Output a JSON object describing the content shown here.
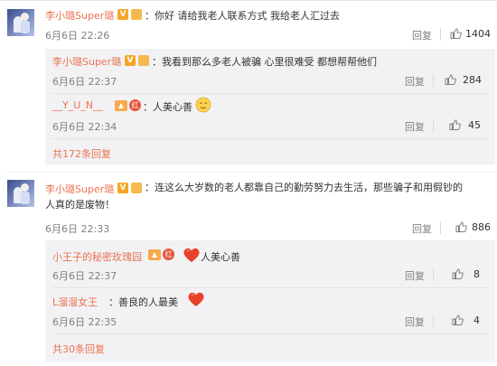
{
  "comments": [
    {
      "username": "李小璐Super璐",
      "text": "：你好 请给我老人联系方式 我给老人汇过去",
      "date": "6月6日 22:26",
      "reply_label": "回复",
      "likes": "1404",
      "replies": [
        {
          "username": "李小璐Super璐",
          "text": "：我看到那么多老人被骗 心里很难受 都想帮帮他们",
          "date": "6月6日 22:37",
          "reply_label": "回复",
          "likes": "284"
        },
        {
          "username": "__Y_U_N__",
          "text": "：人美心善",
          "date": "6月6日 22:34",
          "reply_label": "回复",
          "likes": "45"
        }
      ],
      "more_replies": "共172条回复"
    },
    {
      "username": "李小璐Super璐",
      "text": "：连这么大岁数的老人都靠自己的勤劳努力去生活，那些骗子和用假钞的人真的是废物！",
      "date": "6月6日 22:33",
      "reply_label": "回复",
      "likes": "886",
      "replies": [
        {
          "username": "小王子的秘密玫瑰园",
          "text": "人美心善",
          "date": "6月6日 22:37",
          "reply_label": "回复",
          "likes": "8"
        },
        {
          "username": "L溜溜女王",
          "text": "：善良的人最美",
          "date": "6月6日 22:35",
          "reply_label": "回复",
          "likes": "4"
        }
      ],
      "more_replies": "共30条回复"
    }
  ],
  "badges": {
    "verified": "V",
    "red": "红"
  },
  "colors": {
    "username": "#eb7350",
    "meta": "#808080",
    "sub_bg": "#f2f2f5",
    "heart": "#e8412c"
  },
  "icons": [
    "like-icon",
    "heart-emoji",
    "smile-emoji",
    "verified-badge",
    "level-badge",
    "red-badge"
  ]
}
